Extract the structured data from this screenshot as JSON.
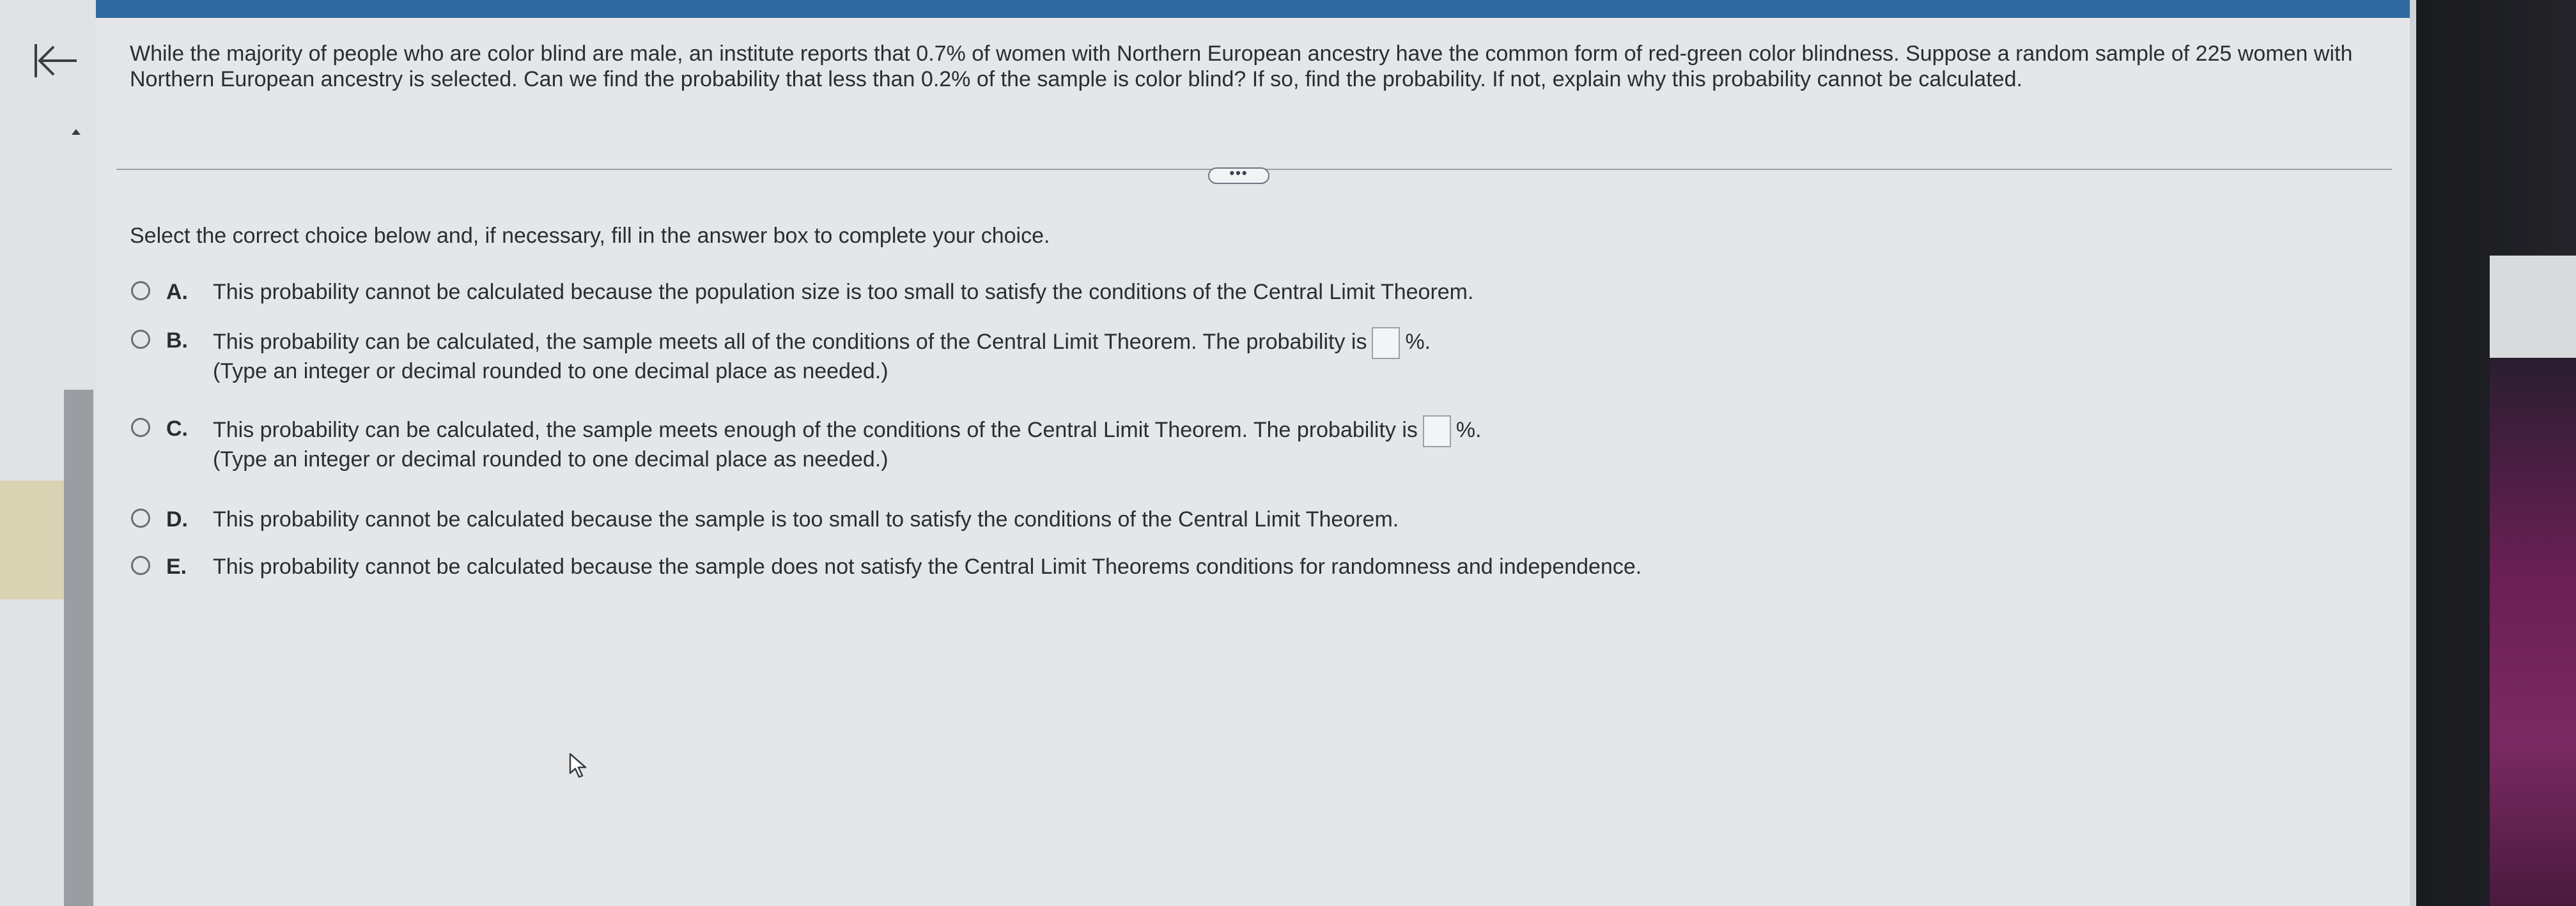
{
  "question": {
    "text": "While the majority of people who are color blind are male, an institute reports that 0.7% of women with Northern European ancestry have the common form of red-green color blindness. Suppose a random sample of 225 women with Northern European ancestry is selected. Can we find the probability that less than 0.2% of the sample is color blind? If so, find the probability. If not, explain why this probability cannot be calculated."
  },
  "more_button": "•••",
  "instruction": "Select the correct choice below and, if necessary, fill in the answer box to complete your choice.",
  "choices": [
    {
      "letter": "A.",
      "text": "This probability cannot be calculated because the population size is too small to satisfy the conditions of the Central Limit Theorem."
    },
    {
      "letter": "B.",
      "text": "This probability can be calculated, the sample meets all of the conditions of the Central Limit Theorem. The probability is",
      "suffix": "%.",
      "hint": "(Type an integer or decimal rounded to one decimal place as needed.)"
    },
    {
      "letter": "C.",
      "text": "This probability can be calculated, the sample meets enough of the conditions of the Central Limit Theorem. The probability is",
      "suffix": "%.",
      "hint": "(Type an integer or decimal rounded to one decimal place as needed.)"
    },
    {
      "letter": "D.",
      "text": "This probability cannot be calculated because the sample is too small to satisfy the conditions of the Central Limit Theorem."
    },
    {
      "letter": "E.",
      "text": "This probability cannot be calculated because the sample does not satisfy the Central Limit Theorems conditions for randomness and independence."
    }
  ],
  "icons": {
    "back": "back-to-start-icon",
    "scroll_up": "scroll-up-icon",
    "cursor": "mouse-cursor-icon"
  },
  "colors": {
    "topbar": "#2f6aa3",
    "background": "#e4e6e8",
    "text": "#2b2d31"
  }
}
